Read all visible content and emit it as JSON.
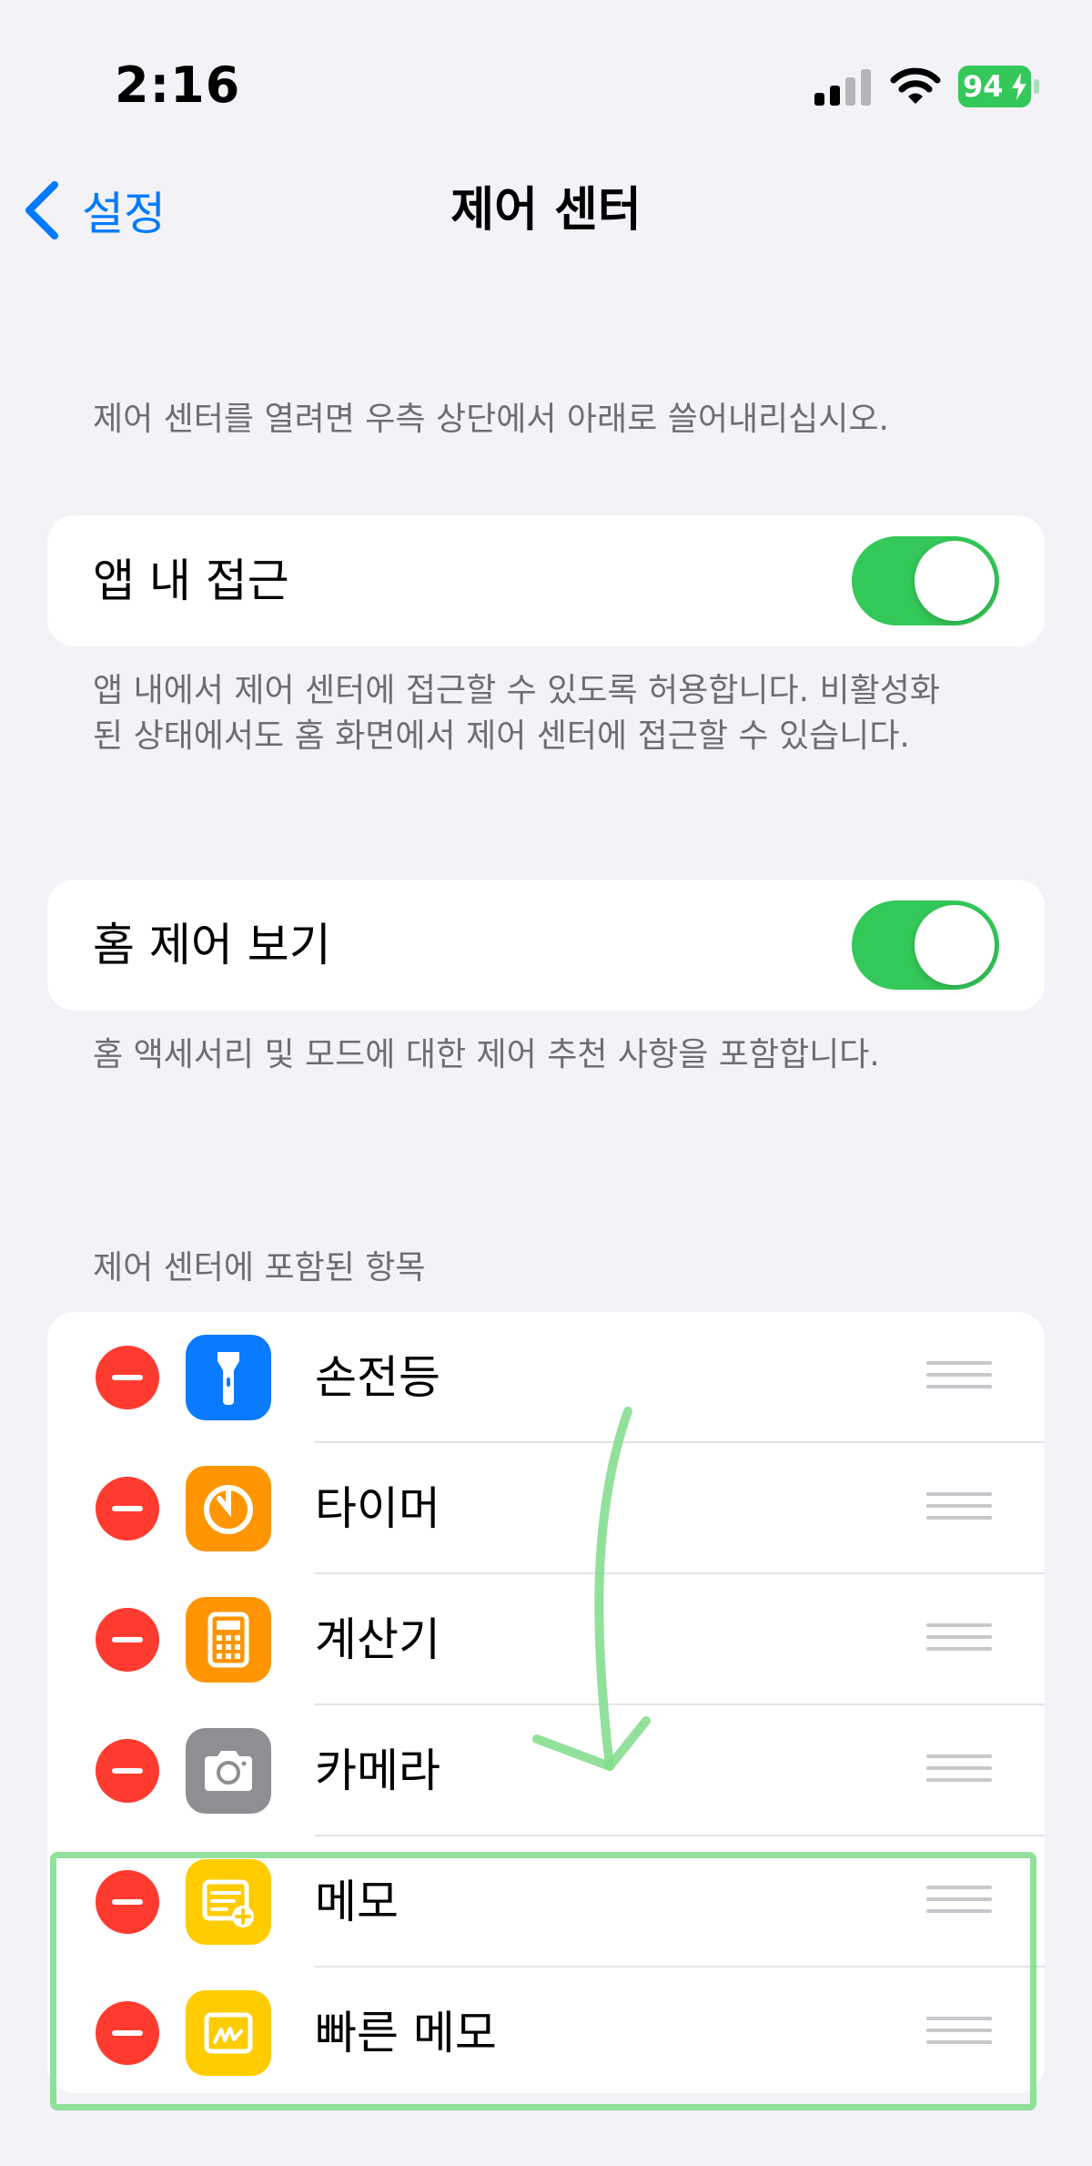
{
  "status_bar": {
    "time": "2:16",
    "battery": "94"
  },
  "nav": {
    "back_label": "설정",
    "title": "제어 센터"
  },
  "intro_text": "제어 센터를 열려면 우측 상단에서 아래로 쓸어내리십시오.",
  "access_in_apps": {
    "label": "앱 내 접근",
    "enabled": true,
    "footer": "앱 내에서 제어 센터에 접근할 수 있도록 허용합니다. 비활성화된 상태에서도 홈 화면에서 제어 센터에 접근할 수 있습니다."
  },
  "home_controls": {
    "label": "홈 제어 보기",
    "enabled": true,
    "footer": "홈 액세서리 및 모드에 대한 제어 추천 사항을 포함합니다."
  },
  "included": {
    "header": "제어 센터에 포함된 항목",
    "items": [
      {
        "label": "손전등",
        "icon": "flashlight-icon",
        "color": "#0a7aff"
      },
      {
        "label": "타이머",
        "icon": "timer-icon",
        "color": "#ff9500"
      },
      {
        "label": "계산기",
        "icon": "calculator-icon",
        "color": "#ff9500"
      },
      {
        "label": "카메라",
        "icon": "camera-icon",
        "color": "#8e8e93"
      },
      {
        "label": "메모",
        "icon": "notes-icon",
        "color": "#ffcc00"
      },
      {
        "label": "빠른 메모",
        "icon": "quick-note-icon",
        "color": "#ffcc00"
      }
    ]
  },
  "colors": {
    "accent": "#007aff",
    "toggle_on": "#34c759",
    "delete": "#ff3b30",
    "annotation": "#7fdc8a"
  }
}
